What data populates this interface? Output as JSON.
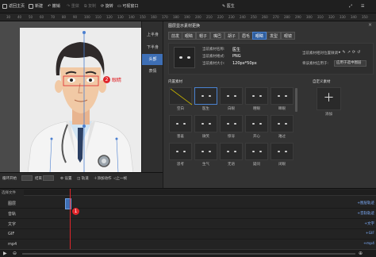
{
  "toolbar": {
    "back_home": "返回主页",
    "new": "新建",
    "undo": "撤销",
    "redo": "重做",
    "copy": "复制",
    "rotate": "旋转",
    "visible_window": "可视窗口",
    "doc_title": "医生"
  },
  "ruler": {
    "ticks": [
      "30",
      "40",
      "50",
      "60",
      "70",
      "80",
      "90",
      "100",
      "110",
      "120",
      "130",
      "140",
      "150",
      "160",
      "170",
      "180",
      "190",
      "200",
      "210",
      "220",
      "230",
      "240",
      "250",
      "260",
      "270",
      "280",
      "290",
      "300",
      "310",
      "320",
      "330",
      "340",
      "350"
    ]
  },
  "canvas": {
    "marker_number": "2",
    "marker_text": "眼睛"
  },
  "side_tabs": [
    "上半身",
    "下半身",
    "头部",
    "表情"
  ],
  "panel": {
    "title": "图层显示素材更换",
    "tabs": [
      "前发",
      "眼睛",
      "帽子",
      "嘴巴",
      "胡子",
      "眉毛",
      "眼睛",
      "发型",
      "眼镜"
    ],
    "active_tab_index": 6,
    "info": {
      "name_label": "当前素材名称:",
      "name_value": "医生",
      "format_label": "当前素材格式:",
      "format_value": "PNG",
      "size_label": "当前素材大小:",
      "size_value": "120px*50px",
      "position_label": "当前素材相对位置微调",
      "replace_label": "将该素材应用于:",
      "replace_value": "应用于选中图层"
    },
    "builtin_title": "内置素材",
    "custom_title": "自定义素材",
    "add_label": "添加",
    "tiles": [
      {
        "label": "空白",
        "kind": "blank"
      },
      {
        "label": "医生",
        "kind": "eyes",
        "selected": true
      },
      {
        "label": "白眼",
        "kind": "eyes"
      },
      {
        "label": "瞪眼",
        "kind": "eyes"
      },
      {
        "label": "眯眼",
        "kind": "eyes"
      },
      {
        "label": "害羞",
        "kind": "eyes"
      },
      {
        "label": "微笑",
        "kind": "eyes"
      },
      {
        "label": "惊讶",
        "kind": "eyes"
      },
      {
        "label": "开心",
        "kind": "eyes"
      },
      {
        "label": "难过",
        "kind": "eyes"
      },
      {
        "label": "思考",
        "kind": "eyes"
      },
      {
        "label": "生气",
        "kind": "eyes"
      },
      {
        "label": "无语",
        "kind": "eyes"
      },
      {
        "label": "疑问",
        "kind": "eyes"
      },
      {
        "label": "闭眼",
        "kind": "eyes"
      }
    ]
  },
  "timeline_toolbar": {
    "loop": "循环开始",
    "end": "结束",
    "settings": "设置",
    "track": "轨道",
    "add_anim": "添加动作",
    "prev_frame": "上一帧"
  },
  "timeline": {
    "header": "选择文件",
    "rows": [
      {
        "name": "图层",
        "right": "+图层轨迹"
      },
      {
        "name": "音轨",
        "right": "+音轨轨迹"
      },
      {
        "name": "文字",
        "right": "+文字"
      },
      {
        "name": "GIF",
        "right": "+GIF"
      },
      {
        "name": "mp4",
        "right": "+mp4"
      }
    ],
    "playhead_marker": "1"
  },
  "colors": {
    "accent": "#3e6fb5",
    "marker_red": "#e0262b",
    "skin": "#f1c9a5",
    "coat": "#f4f4f4"
  }
}
